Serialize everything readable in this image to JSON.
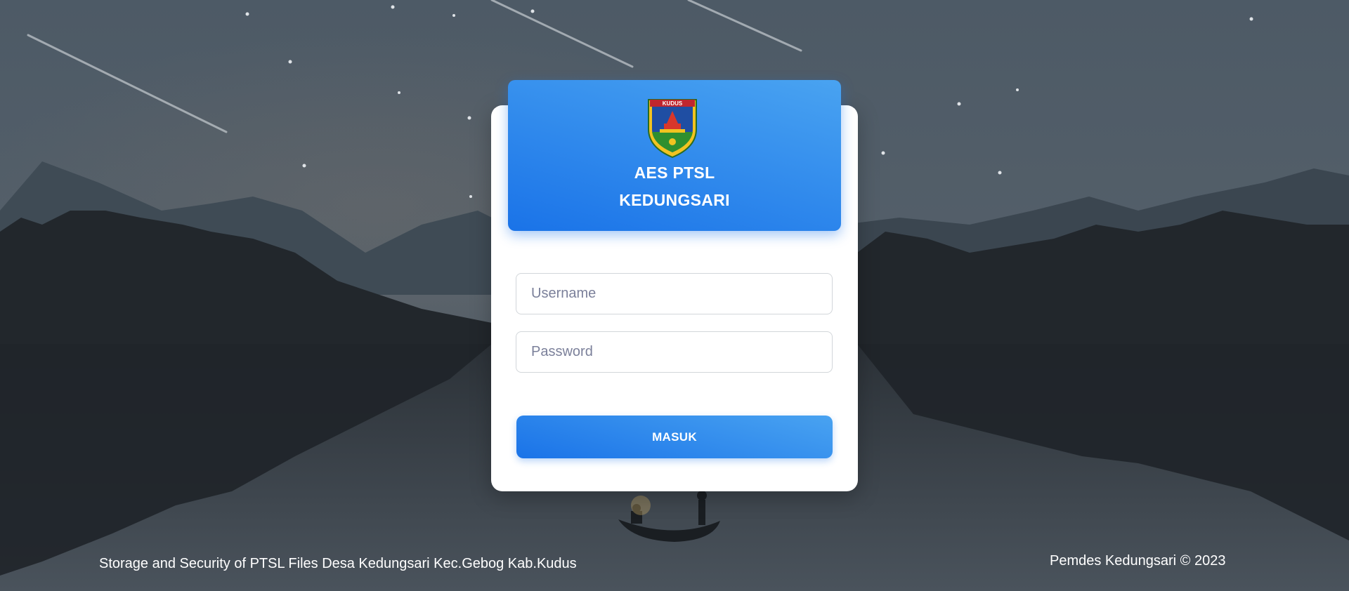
{
  "header": {
    "logo_text": "KUDUS",
    "title_line1": "AES PTSL",
    "title_line2": "KEDUNGSARI"
  },
  "form": {
    "username_placeholder": "Username",
    "username_value": "",
    "password_placeholder": "Password",
    "password_value": "",
    "submit_label": "MASUK"
  },
  "footer": {
    "left_text": "Storage and Security of PTSL Files Desa Kedungsari Kec.Gebog Kab.Kudus",
    "right_text": "Pemdes Kedungsari © 2023"
  },
  "colors": {
    "accent_light": "#49a3f1",
    "accent": "#1a73e8"
  }
}
